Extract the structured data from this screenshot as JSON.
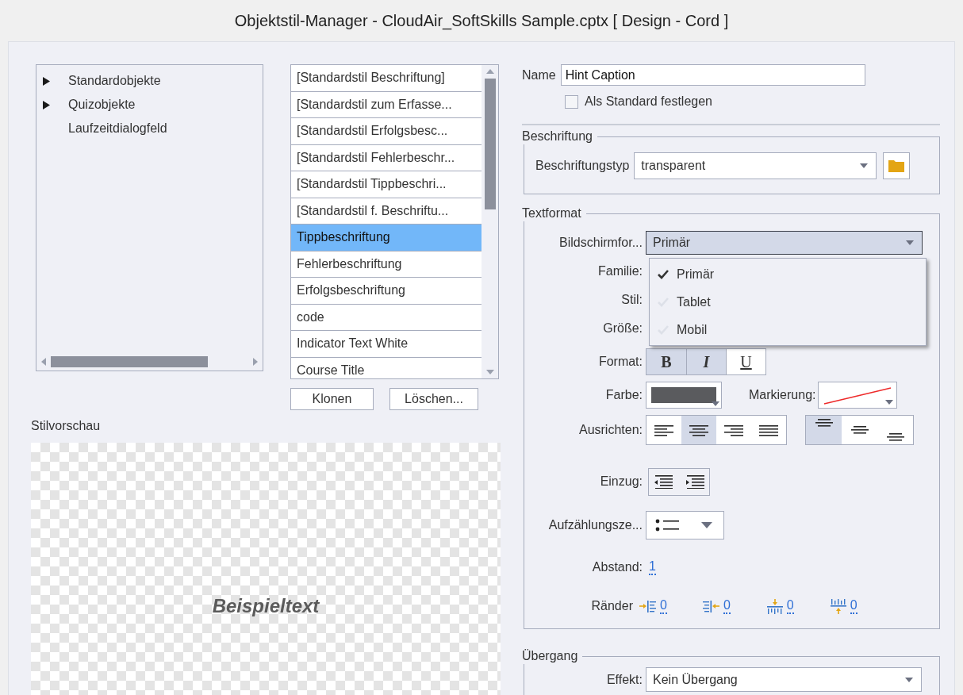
{
  "window": {
    "title": "Objektstil-Manager - CloudAir_SoftSkills Sample.cptx [ Design - Cord ]"
  },
  "tree": {
    "items": [
      {
        "label": "Standardobjekte",
        "kind": "group"
      },
      {
        "label": "Quizobjekte",
        "kind": "group"
      },
      {
        "label": "Laufzeitdialogfeld",
        "kind": "leaf"
      }
    ]
  },
  "styles": {
    "items": [
      {
        "label": "[Standardstil Beschriftung]",
        "selected": false
      },
      {
        "label": "[Standardstil zum Erfasse...",
        "selected": false
      },
      {
        "label": "[Standardstil Erfolgsbesc...",
        "selected": false
      },
      {
        "label": "[Standardstil Fehlerbeschr...",
        "selected": false
      },
      {
        "label": "[Standardstil Tippbeschri...",
        "selected": false
      },
      {
        "label": "[Standardstil f. Beschriftu...",
        "selected": false
      },
      {
        "label": "Tippbeschriftung",
        "selected": true
      },
      {
        "label": "Fehlerbeschriftung",
        "selected": false
      },
      {
        "label": "Erfolgsbeschriftung",
        "selected": false
      },
      {
        "label": "code",
        "selected": false
      },
      {
        "label": "Indicator Text White",
        "selected": false
      },
      {
        "label": "Course Title",
        "selected": false
      }
    ],
    "buttons": [
      "Klonen",
      "Löschen..."
    ]
  },
  "preview": {
    "label": "Stilvorschau",
    "sample": "Beispieltext"
  },
  "name": {
    "label": "Name",
    "value": "Hint Caption"
  },
  "default_checkbox": {
    "label": "Als Standard festlegen",
    "checked": false
  },
  "caption": {
    "title": "Beschriftung",
    "type_label": "Beschriftungstyp",
    "type_value": "transparent"
  },
  "text_format": {
    "title": "Textformat",
    "screen_label": "Bildschirmfor...",
    "screen_value": "Primär",
    "expanded": true,
    "screen_options": [
      {
        "label": "Primär",
        "selected": true
      },
      {
        "label": "Tablet",
        "selected": false
      },
      {
        "label": "Mobil",
        "selected": false
      }
    ],
    "family_label": "Familie:",
    "style_label": "Stil:",
    "size_label": "Größe:",
    "format_label": "Format:",
    "format_buttons": [
      {
        "label": "B",
        "kind": "bold",
        "on": true
      },
      {
        "label": "I",
        "kind": "italic",
        "on": true
      },
      {
        "label": "U",
        "kind": "underline",
        "on": false
      }
    ],
    "color_label": "Farbe:",
    "color": "#5a5b5e",
    "highlight_label": "Markierung:",
    "align_label": "Ausrichten:",
    "align": [
      {
        "kind": "left",
        "selected": false
      },
      {
        "kind": "center",
        "selected": true
      },
      {
        "kind": "right",
        "selected": false
      },
      {
        "kind": "justify",
        "selected": false
      }
    ],
    "valign": [
      {
        "kind": "top",
        "selected": true
      },
      {
        "kind": "middle",
        "selected": false
      },
      {
        "kind": "bottom",
        "selected": false
      }
    ],
    "indent_label": "Einzug:",
    "bullets_label": "Aufzählungsze...",
    "spacing_label": "Abstand:",
    "spacing_value": "1",
    "margins_label": "Ränder",
    "margins": [
      {
        "kind": "left",
        "value": "0"
      },
      {
        "kind": "right",
        "value": "0"
      },
      {
        "kind": "top",
        "value": "0"
      },
      {
        "kind": "bottom",
        "value": "0"
      }
    ]
  },
  "transition": {
    "title": "Übergang",
    "effect_label": "Effekt:",
    "effect_value": "Kein Übergang"
  }
}
